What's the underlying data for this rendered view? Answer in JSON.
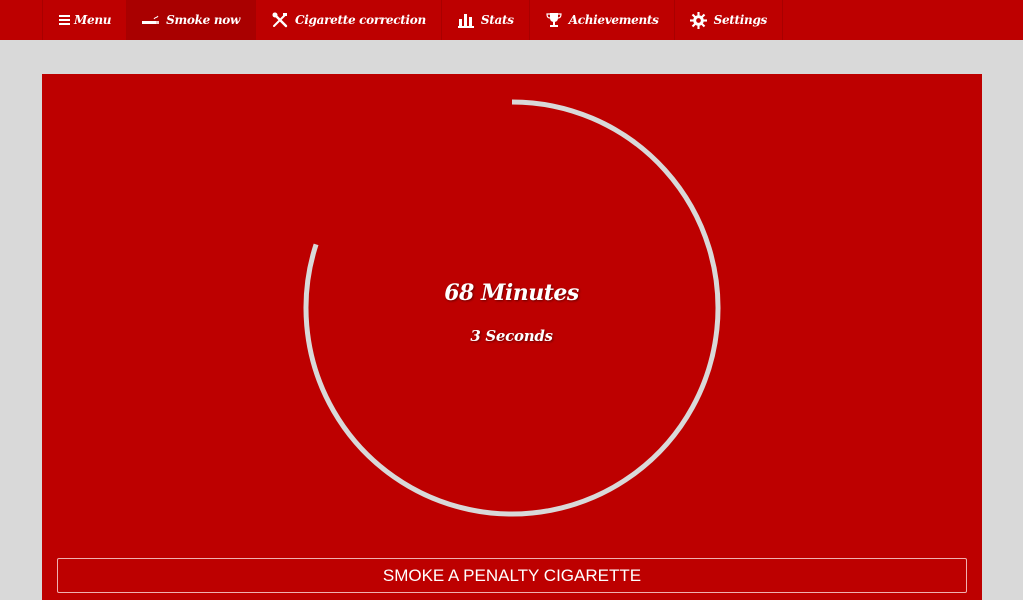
{
  "nav": {
    "items": [
      {
        "label": "Menu",
        "icon": "hamburger-icon"
      },
      {
        "label": "Smoke now",
        "icon": "cigarette-icon",
        "active": true
      },
      {
        "label": "Cigarette correction",
        "icon": "tools-icon"
      },
      {
        "label": "Stats",
        "icon": "bar-chart-icon"
      },
      {
        "label": "Achievements",
        "icon": "trophy-icon"
      },
      {
        "label": "Settings",
        "icon": "gear-icon"
      }
    ]
  },
  "timer": {
    "minutes_text": "68 Minutes",
    "seconds_text": "3 Seconds",
    "progress": 0.8
  },
  "penalty_button": {
    "label": "SMOKE A PENALTY CIGARETTE"
  },
  "colors": {
    "brand_red": "#bd0000",
    "nav_active": "#a90000",
    "background": "#d9d9d9",
    "ring": "#d9d9d9"
  }
}
